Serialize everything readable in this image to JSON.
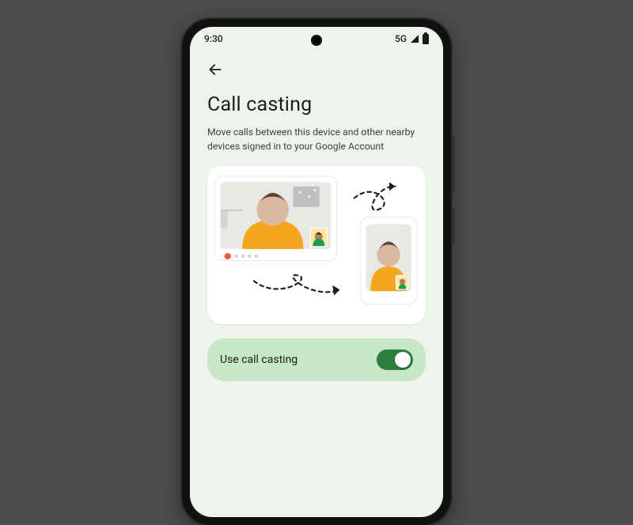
{
  "statusbar": {
    "time": "9:30",
    "network": "5G"
  },
  "page": {
    "title": "Call casting",
    "subtitle": "Move calls between this device and other nearby devices signed in to your Google Account"
  },
  "toggle": {
    "label": "Use call casting",
    "state_on": true
  },
  "colors": {
    "screen_bg": "#eef3eb",
    "toggle_card_bg": "#c6e8c6",
    "switch_on": "#2e7d3f"
  }
}
